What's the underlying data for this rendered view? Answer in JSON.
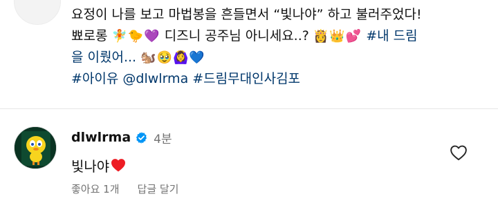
{
  "caption": {
    "line1": "요정이 나를 보고 마법봉을 흔들면서 “빛나야” 하고 불러주었다!",
    "line2_text_a": "뾰로롱",
    "line2_emoji_a": "🧚🐤💜",
    "line2_text_b": "디즈니 공주님 아니세요..?",
    "line2_emoji_b": "👸👑💕",
    "line2_hash": "#내",
    "line2_text_c": "드림",
    "line3_text": "을 이뤘어...",
    "line3_emoji": "🐿️🥹🙆‍♀️💙",
    "hashtags": [
      "#아이유",
      "@dlwlrma",
      "#드림무대인사김포"
    ]
  },
  "comment": {
    "username": "dlwlrma",
    "verified_icon": "verified-badge-icon",
    "time": "4분",
    "text": "빛나야",
    "emoji_icon": "red-heart-icon",
    "likes": "좋아요 1개",
    "reply": "답글 달기"
  },
  "colors": {
    "hashtag": "#00376b",
    "verified": "#0095f6",
    "heart": "#ed1c24",
    "muted": "#737373"
  },
  "icons": [
    "heart-outline-icon"
  ]
}
